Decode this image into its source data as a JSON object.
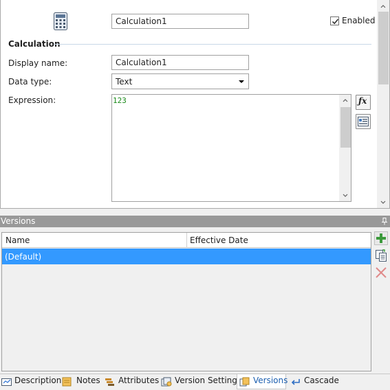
{
  "header": {
    "name_value": "Calculation1",
    "enabled_label": "Enabled",
    "enabled_checked": true
  },
  "calculation": {
    "section_title": "Calculation",
    "display_name_label": "Display name:",
    "display_name_value": "Calculation1",
    "data_type_label": "Data type:",
    "data_type_value": "Text",
    "expression_label": "Expression:",
    "expression_value": "123"
  },
  "versions": {
    "panel_title": "Versions",
    "columns": [
      "Name",
      "Effective Date"
    ],
    "rows": [
      {
        "name": "(Default)",
        "effective_date": "",
        "selected": true
      }
    ]
  },
  "tabs": [
    {
      "label": "Description",
      "icon": "description-icon",
      "active": false
    },
    {
      "label": "Notes",
      "icon": "notes-icon",
      "active": false
    },
    {
      "label": "Attributes",
      "icon": "attributes-icon",
      "active": false
    },
    {
      "label": "Version Settings",
      "icon": "version-settings-icon",
      "active": false
    },
    {
      "label": "Versions",
      "icon": "versions-icon",
      "active": true
    },
    {
      "label": "Cascade",
      "icon": "cascade-icon",
      "active": false
    }
  ],
  "colors": {
    "selection": "#3399ff",
    "panel_header": "#999999",
    "expression_text": "#1a8a1a",
    "active_tab_text": "#1c5fb0"
  }
}
